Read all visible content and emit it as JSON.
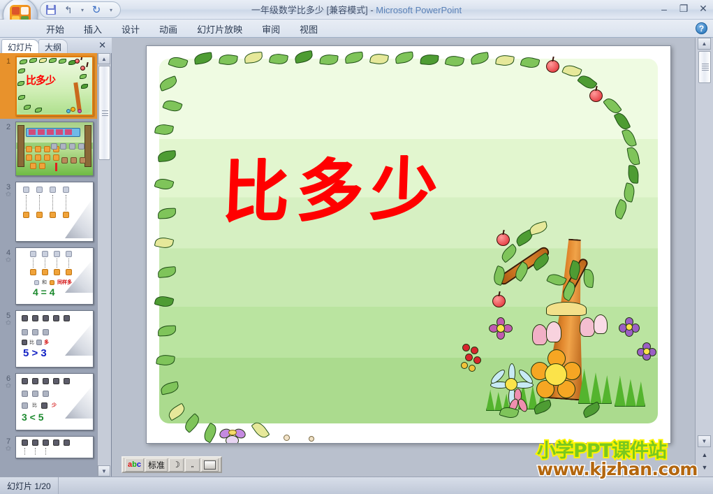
{
  "window": {
    "title": "一年级数学比多少 [兼容模式] - Microsoft PowerPoint",
    "doc_title": "一年级数学比多少 [兼容模式] - ",
    "app_name": "Microsoft PowerPoint",
    "minimize": "–",
    "restore": "❐",
    "close": "✕",
    "office_button": "office-orb",
    "help": "?"
  },
  "quick_access": {
    "save": "save-icon",
    "undo": "↰",
    "undo_more": "▾",
    "redo": "↻",
    "customize": "▾"
  },
  "ribbon": {
    "tabs": [
      {
        "label": "开始",
        "active": false
      },
      {
        "label": "插入",
        "active": false
      },
      {
        "label": "设计",
        "active": false
      },
      {
        "label": "动画",
        "active": false
      },
      {
        "label": "幻灯片放映",
        "active": false
      },
      {
        "label": "审阅",
        "active": false
      },
      {
        "label": "视图",
        "active": false
      }
    ]
  },
  "left_panel": {
    "tabs": [
      {
        "label": "幻灯片",
        "active": true
      },
      {
        "label": "大纲",
        "active": false
      }
    ],
    "close_label": "✕",
    "slides": [
      {
        "number": "1",
        "selected": true,
        "animated": false,
        "kind": "title",
        "title": "比多少",
        "equation": ""
      },
      {
        "number": "2",
        "selected": false,
        "animated": false,
        "kind": "scene",
        "title": "",
        "equation": ""
      },
      {
        "number": "3",
        "selected": false,
        "animated": true,
        "kind": "compare",
        "title": "",
        "equation": ""
      },
      {
        "number": "4",
        "selected": false,
        "animated": true,
        "kind": "compare",
        "title": "",
        "equation": "4 = 4"
      },
      {
        "number": "5",
        "selected": false,
        "animated": true,
        "kind": "compare",
        "title": "",
        "equation": "5 > 3"
      },
      {
        "number": "6",
        "selected": false,
        "animated": true,
        "kind": "compare",
        "title": "",
        "equation": "3 < 5"
      },
      {
        "number": "7",
        "selected": false,
        "animated": true,
        "kind": "compare",
        "title": "",
        "equation": ""
      }
    ],
    "scroll_up": "▲",
    "scroll_down": "▼"
  },
  "slide": {
    "title_text": "比多少",
    "title_color": "#ff0000",
    "background_top": "#effbe2",
    "background_bottom": "#abdb8e",
    "decoration": "apple-tree-and-flowers-border"
  },
  "mini_toolbar": {
    "buttons": [
      {
        "label": "标准",
        "name": "standard-button"
      },
      {
        "label": "",
        "name": "moon-icon-button"
      },
      {
        "label": "",
        "name": "quote-icon-button"
      },
      {
        "label": "",
        "name": "keyboard-icon-button"
      }
    ]
  },
  "right_scroll": {
    "up": "▲",
    "down": "▼",
    "prev_slide": "▲",
    "next_slide": "▼"
  },
  "status_bar": {
    "slide_counter": "幻灯片 1/20"
  },
  "watermark": {
    "line1": "小学PPT课件站",
    "line2": "www.kjzhan.com",
    "line1_color": "#7ac81f",
    "line1_stroke": "#fdf300",
    "line2_color": "#b3660e",
    "line2_stroke": "#ffffff"
  }
}
